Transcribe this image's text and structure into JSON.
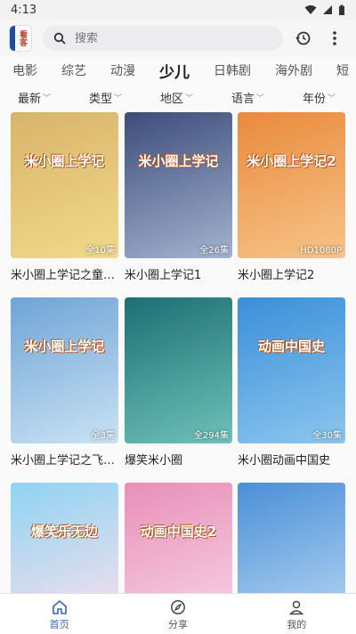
{
  "status": {
    "time": "4:13"
  },
  "app": {
    "logo_text": "看客"
  },
  "search": {
    "placeholder": "搜索"
  },
  "tabs": [
    {
      "label": "电影"
    },
    {
      "label": "综艺"
    },
    {
      "label": "动漫"
    },
    {
      "label": "少儿",
      "active": true
    },
    {
      "label": "日韩剧"
    },
    {
      "label": "海外剧"
    },
    {
      "label": "短"
    }
  ],
  "filters": [
    {
      "label": "最新"
    },
    {
      "label": "类型"
    },
    {
      "label": "地区"
    },
    {
      "label": "语言"
    },
    {
      "label": "年份"
    }
  ],
  "items": [
    {
      "title": "米小圈上学记之童…",
      "badge": "全10集",
      "poster_title": "米小圈上学记",
      "colors": [
        "#d8b46a",
        "#f1d98b"
      ]
    },
    {
      "title": "米小圈上学记1",
      "badge": "全26集",
      "poster_title": "米小圈上学记",
      "colors": [
        "#3d4c7a",
        "#a3b3d0"
      ]
    },
    {
      "title": "米小圈上学记2",
      "badge": "HD1080P",
      "poster_title": "米小圈上学记2",
      "colors": [
        "#e98a3c",
        "#f7c489"
      ]
    },
    {
      "title": "米小圈上学记之飞…",
      "badge": "全3集",
      "poster_title": "米小圈上学记",
      "colors": [
        "#6fa4d6",
        "#c9e2f3"
      ]
    },
    {
      "title": "爆笑米小圈",
      "badge": "全294集",
      "poster_title": "",
      "colors": [
        "#1d6f73",
        "#6ec2b9"
      ]
    },
    {
      "title": "米小圈动画中国史",
      "badge": "全30集",
      "poster_title": "动画中国史",
      "colors": [
        "#3a8fd8",
        "#8cc6ef"
      ]
    },
    {
      "title": "",
      "badge": "",
      "poster_title": "爆笑乐无边",
      "colors": [
        "#8fd3f2",
        "#fbe0ec"
      ]
    },
    {
      "title": "",
      "badge": "",
      "poster_title": "动画中国史2",
      "colors": [
        "#e88fb8",
        "#f7d4e6"
      ]
    },
    {
      "title": "",
      "badge": "",
      "poster_title": "",
      "colors": [
        "#4a8fd6",
        "#b7d7f3"
      ]
    }
  ],
  "nav": [
    {
      "label": "首页",
      "icon": "home-icon",
      "active": true
    },
    {
      "label": "分享",
      "icon": "compass-icon"
    },
    {
      "label": "我的",
      "icon": "person-icon"
    }
  ]
}
